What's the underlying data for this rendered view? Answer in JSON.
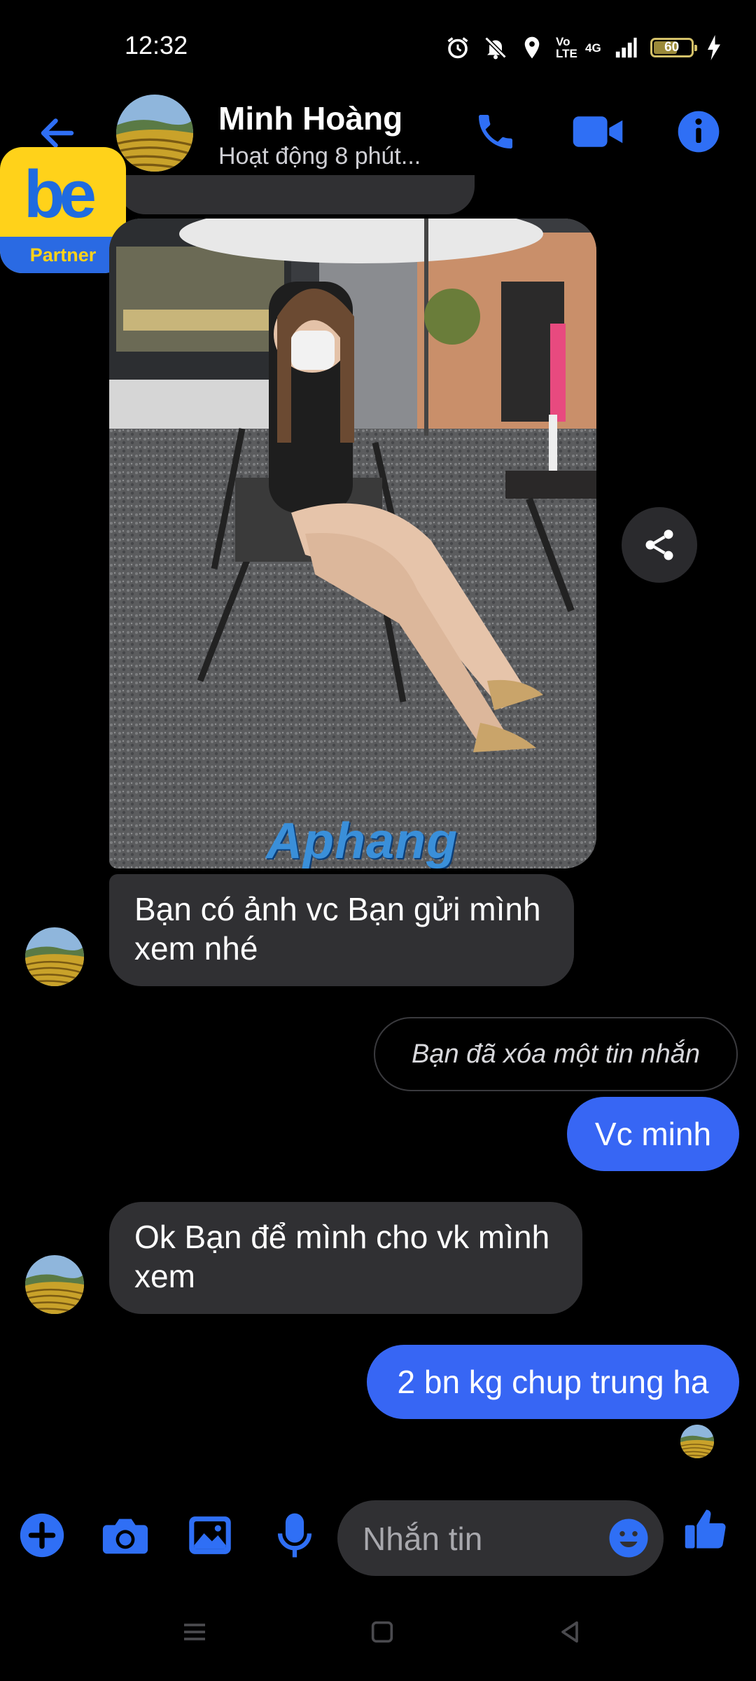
{
  "status_bar": {
    "time": "12:32",
    "network": "4G",
    "volte": "Vo LTE",
    "battery": "60"
  },
  "header": {
    "name": "Minh Hoàng",
    "status": "Hoạt động 8 phút..."
  },
  "partner_badge": {
    "logo": "be",
    "label": "Partner"
  },
  "photo": {
    "watermark": "Aphang"
  },
  "messages": [
    {
      "dir": "in",
      "text": "Bạn có ảnh vc Bạn gửi mình xem nhé"
    },
    {
      "dir": "out",
      "text": "Bạn đã xóa một tin nhắn",
      "deleted": true
    },
    {
      "dir": "out",
      "text": "Vc minh"
    },
    {
      "dir": "in",
      "text": "Ok Bạn để mình cho vk mình xem"
    },
    {
      "dir": "out",
      "text": "2 bn kg chup trung ha"
    }
  ],
  "composer": {
    "placeholder": "Nhắn tin"
  },
  "icons": {
    "back": "arrow-left-icon",
    "call": "phone-icon",
    "video": "video-camera-icon",
    "info": "info-icon",
    "share": "share-icon",
    "add": "plus-icon",
    "camera": "camera-icon",
    "gallery": "image-icon",
    "mic": "microphone-icon",
    "emoji": "smile-icon",
    "like": "thumbs-up-icon"
  },
  "colors": {
    "accent": "#3766f4",
    "icon_blue": "#2f6ff5",
    "incoming_bubble": "#303033",
    "background": "#000000"
  }
}
